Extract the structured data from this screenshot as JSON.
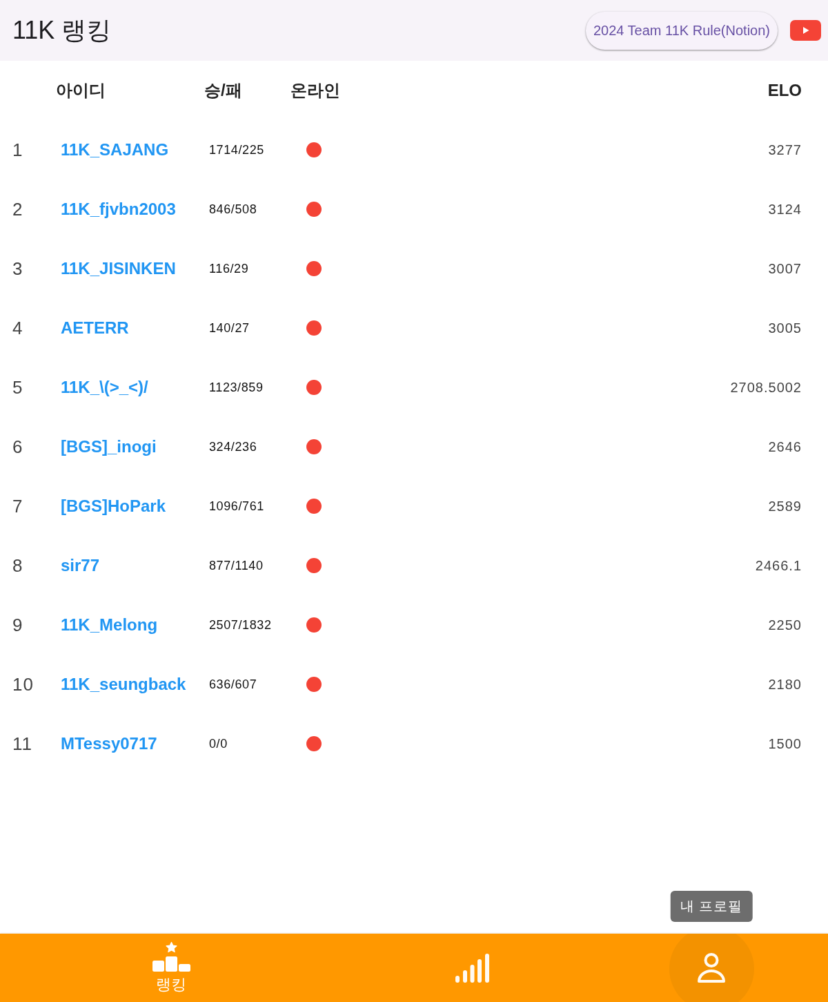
{
  "header": {
    "title": "11K 랭킹",
    "rule_button": "2024 Team 11K Rule(Notion)"
  },
  "table": {
    "columns": [
      "아이디",
      "승/패",
      "온라인",
      "ELO"
    ],
    "rows": [
      {
        "rank": "1",
        "id": "11K_SAJANG",
        "record": "1714/225",
        "online": false,
        "elo": "3277"
      },
      {
        "rank": "2",
        "id": "11K_fjvbn2003",
        "record": "846/508",
        "online": false,
        "elo": "3124"
      },
      {
        "rank": "3",
        "id": "11K_JISINKEN",
        "record": "116/29",
        "online": false,
        "elo": "3007"
      },
      {
        "rank": "4",
        "id": "AETERR",
        "record": "140/27",
        "online": false,
        "elo": "3005"
      },
      {
        "rank": "5",
        "id": "11K_\\(>_<)/",
        "record": "1123/859",
        "online": false,
        "elo": "2708.5002"
      },
      {
        "rank": "6",
        "id": "[BGS]_inogi",
        "record": "324/236",
        "online": false,
        "elo": "2646"
      },
      {
        "rank": "7",
        "id": "[BGS]HoPark",
        "record": "1096/761",
        "online": false,
        "elo": "2589"
      },
      {
        "rank": "8",
        "id": "sir77",
        "record": "877/1140",
        "online": false,
        "elo": "2466.1"
      },
      {
        "rank": "9",
        "id": "11K_Melong",
        "record": "2507/1832",
        "online": false,
        "elo": "2250"
      },
      {
        "rank": "10",
        "id": "11K_seungback",
        "record": "636/607",
        "online": false,
        "elo": "2180"
      },
      {
        "rank": "11",
        "id": "MTessy0717",
        "record": "0/0",
        "online": false,
        "elo": "1500"
      }
    ]
  },
  "bottom_nav": [
    {
      "kind": "ranking",
      "label": "랭킹",
      "selected": true,
      "hovered": false
    },
    {
      "kind": "stats",
      "selected": false,
      "hovered": false
    },
    {
      "kind": "profile",
      "selected": false,
      "hovered": true,
      "tooltip": "내 프로필"
    }
  ]
}
